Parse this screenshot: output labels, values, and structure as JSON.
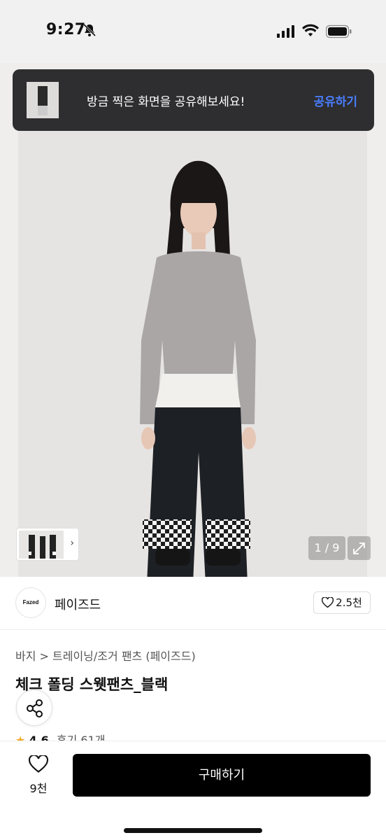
{
  "status_bar": {
    "time": "9:27"
  },
  "toast": {
    "message": "방금 찍은 화면을 공유해보세요!",
    "action_label": "공유하기"
  },
  "gallery": {
    "counter": "1 / 9"
  },
  "brand": {
    "logo_text": "Fazed",
    "name": "페이즈드",
    "likes": "2.5천"
  },
  "product": {
    "breadcrumb": "바지 > 트레이닝/조거 팬츠 (페이즈드)",
    "title": "체크 폴딩 스웻팬츠_블랙",
    "rating_score": "4.6",
    "reviews": "후기 61개"
  },
  "bottom_bar": {
    "wish_count": "9천",
    "buy_label": "구매하기"
  },
  "colors": {
    "toast_bg": "#2e2e30",
    "toast_action": "#4a7dff",
    "buy_button": "#000000",
    "star": "#f5a623"
  },
  "icons": [
    "muted-bell-icon",
    "signal-icon",
    "wifi-icon",
    "battery-icon",
    "chevron-right-icon",
    "expand-icon",
    "heart-icon",
    "share-icon",
    "star-icon"
  ]
}
